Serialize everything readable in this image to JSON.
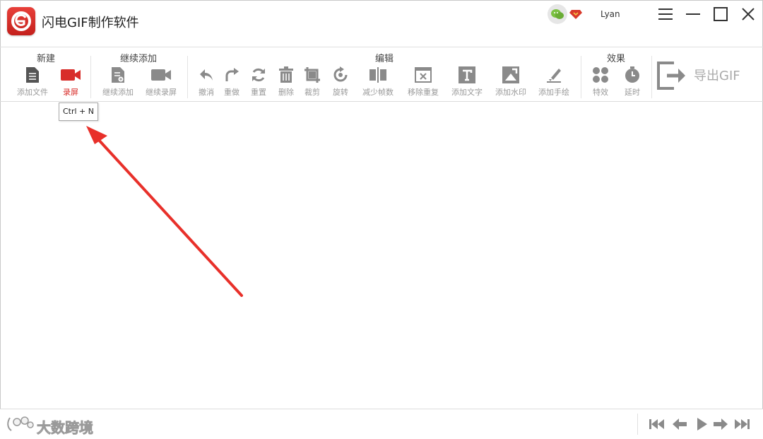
{
  "window": {
    "title": "闪电GIF制作软件",
    "username": "Lyan"
  },
  "toolbar": {
    "groups": {
      "new": "新建",
      "continue": "继续添加",
      "edit": "编辑",
      "effects": "效果"
    },
    "tools": {
      "add_file": "添加文件",
      "record": "录屏",
      "continue_add": "继续添加",
      "continue_record": "继续录屏",
      "undo": "撤消",
      "redo": "重做",
      "reset": "重置",
      "delete": "删除",
      "crop": "裁剪",
      "rotate": "旋转",
      "reduce_frames": "减少帧数",
      "remove_duplicates": "移除重复",
      "add_text": "添加文字",
      "add_watermark": "添加水印",
      "add_drawing": "添加手绘",
      "effects": "特效",
      "delay": "延时"
    },
    "export_label": "导出GIF"
  },
  "tooltip": {
    "text": "Ctrl + N"
  },
  "footer": {
    "watermark": "大数跨境"
  },
  "colors": {
    "accent": "#d82d2a",
    "icon": "#8a8a8a",
    "arrow": "#e8302a"
  }
}
